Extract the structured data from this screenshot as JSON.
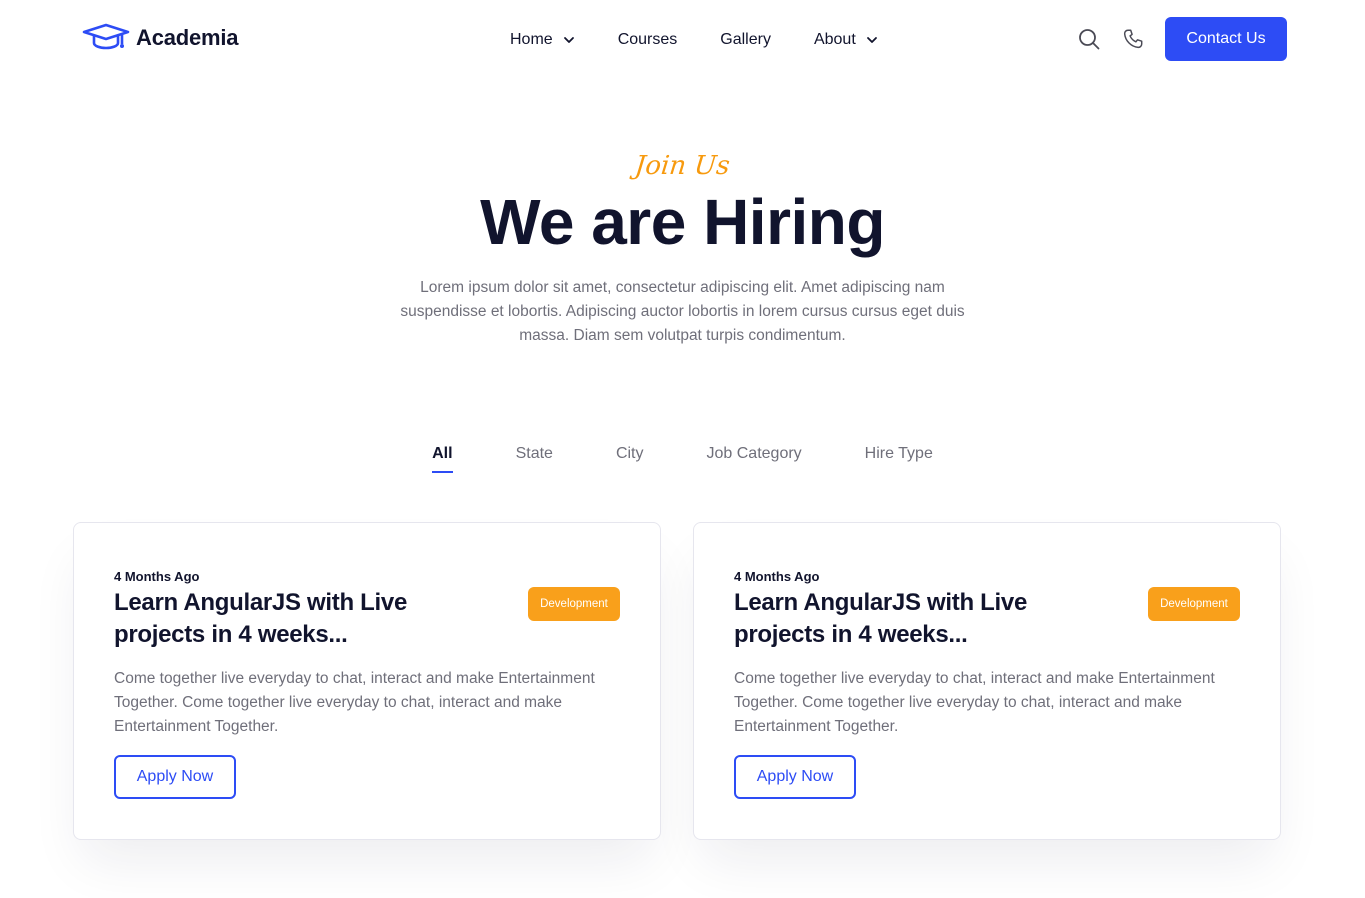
{
  "brand": {
    "name": "Academia",
    "accent": "#2d4cf5",
    "logo_icon": "graduation-cap-icon"
  },
  "nav": {
    "items": [
      {
        "label": "Home",
        "has_dropdown": true
      },
      {
        "label": "Courses",
        "has_dropdown": false
      },
      {
        "label": "Gallery",
        "has_dropdown": false
      },
      {
        "label": "About",
        "has_dropdown": true
      }
    ]
  },
  "header_actions": {
    "search_icon": "search-icon",
    "phone_icon": "phone-icon",
    "contact_label": "Contact Us"
  },
  "hero": {
    "eyebrow": "Join Us",
    "title": "We are Hiring",
    "description": "Lorem ipsum dolor sit amet, consectetur adipiscing elit. Amet adipiscing nam suspendisse et lobortis. Adipiscing auctor lobortis in lorem cursus cursus eget duis massa. Diam sem volutpat turpis condimentum."
  },
  "tabs": [
    {
      "label": "All",
      "active": true
    },
    {
      "label": "State",
      "active": false
    },
    {
      "label": "City",
      "active": false
    },
    {
      "label": "Job Category",
      "active": false
    },
    {
      "label": "Hire Type",
      "active": false
    }
  ],
  "jobs": [
    {
      "posted": "4 Months Ago",
      "title": "Learn AngularJS with Live projects in 4 weeks...",
      "category": "Development",
      "description": "Come together live everyday to chat, interact and make Entertainment Together. Come together live everyday to chat, interact and make Entertainment Together.",
      "cta": "Apply Now"
    },
    {
      "posted": "4 Months Ago",
      "title": "Learn AngularJS with Live projects in 4 weeks...",
      "category": "Development",
      "description": "Come together live everyday to chat, interact and make Entertainment Together. Come together live everyday to chat, interact and make Entertainment Together.",
      "cta": "Apply Now"
    }
  ],
  "colors": {
    "accent": "#2d4cf5",
    "badge": "#f9a01b",
    "eyebrow": "#f79a0e",
    "heading": "#11142d",
    "body_text": "#6f6f7a"
  }
}
